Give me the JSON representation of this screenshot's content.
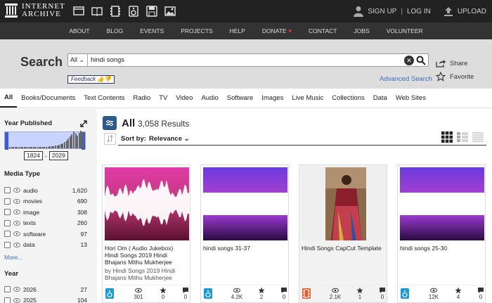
{
  "brand": {
    "line1": "INTERNET",
    "line2": "ARCHIVE"
  },
  "topbar": {
    "signup": "SIGN UP",
    "separator": "|",
    "login": "LOG IN",
    "upload": "UPLOAD",
    "media_icons": [
      "web-icon",
      "texts-icon",
      "video-icon",
      "audio-icon",
      "software-icon",
      "images-icon"
    ]
  },
  "nav": [
    "ABOUT",
    "BLOG",
    "EVENTS",
    "PROJECTS",
    "HELP",
    "DONATE",
    "CONTACT",
    "JOBS",
    "VOLUNTEER"
  ],
  "search": {
    "title": "Search",
    "scope": "All",
    "query": "hindi songs",
    "feedback": "Feedback",
    "advanced": "Advanced Search",
    "share": "Share",
    "favorite": "Favorite"
  },
  "tabs": [
    "All",
    "Books/Documents",
    "Text Contents",
    "Radio",
    "TV",
    "Video",
    "Audio",
    "Software",
    "Images",
    "Live Music",
    "Collections",
    "Data",
    "Web Sites"
  ],
  "sidebar": {
    "year_published_title": "Year Published",
    "year_min": "1824",
    "year_max": "2029",
    "range_sep": "-",
    "media_type_title": "Media Type",
    "media_types": [
      {
        "label": "audio",
        "count": "1,620"
      },
      {
        "label": "movies",
        "count": "690"
      },
      {
        "label": "image",
        "count": "308"
      },
      {
        "label": "texts",
        "count": "260"
      },
      {
        "label": "software",
        "count": "97"
      },
      {
        "label": "data",
        "count": "13"
      }
    ],
    "more": "More...",
    "year_title": "Year",
    "years": [
      {
        "label": "2026",
        "count": "27"
      },
      {
        "label": "2025",
        "count": "104"
      }
    ]
  },
  "results": {
    "heading": "All",
    "count": "3,058 Results",
    "sort_label": "Sort by:",
    "sort_value": "Relevance"
  },
  "cards": [
    {
      "title": "Hori Om ( Audio Jukebox) Hindi Songs 2019 Hindi Bhajans Mithu Mukherjee",
      "by": "by Hindi Songs 2019 Hindi Bhajans Mithu Mukherjee",
      "views": "301",
      "favs": "0",
      "reviews": "0",
      "type": "audio"
    },
    {
      "title": "hindi songs 31-37",
      "by": "",
      "views": "4.2K",
      "favs": "2",
      "reviews": "0",
      "type": "audio"
    },
    {
      "title": "Hindi Songs CapCut Template",
      "by": "",
      "views": "2.1K",
      "favs": "1",
      "reviews": "0",
      "type": "movies"
    },
    {
      "title": "hindi songs 25-30",
      "by": "",
      "views": "12K",
      "favs": "4",
      "reviews": "0",
      "type": "audio"
    }
  ],
  "colors": {
    "accent": "#3b6ebf",
    "topbar": "#222222",
    "audio_badge": "#1c9ad6",
    "movie_badge": "#e55a2b"
  }
}
